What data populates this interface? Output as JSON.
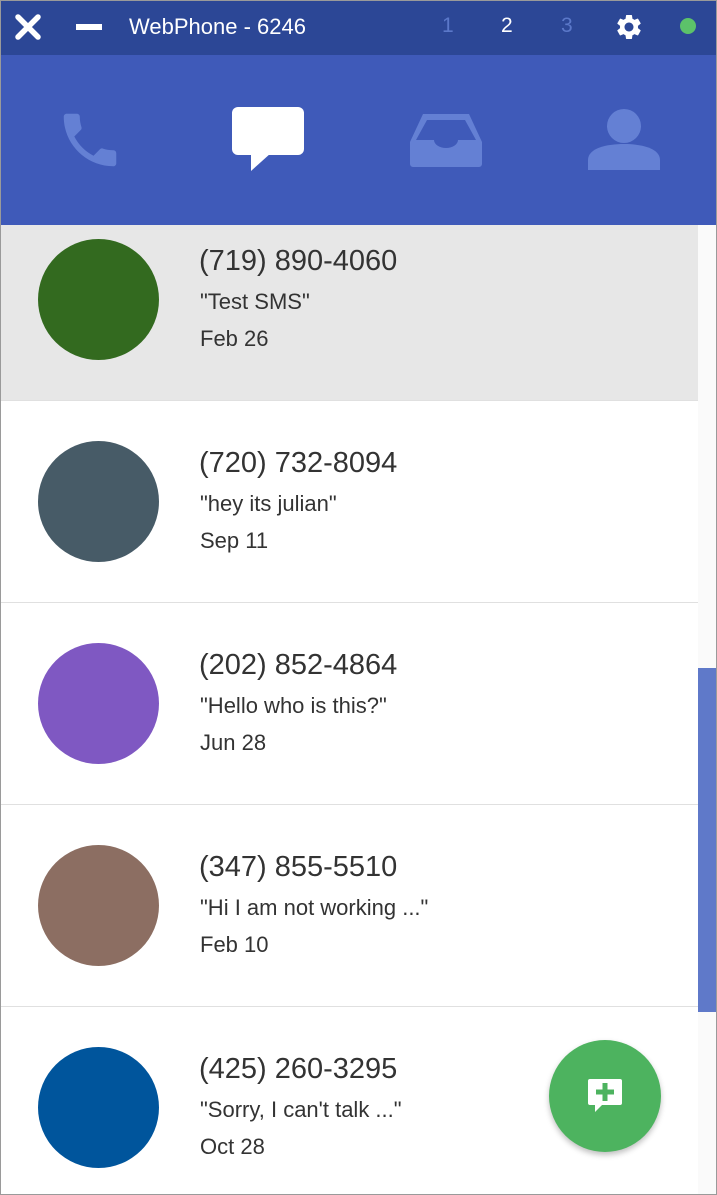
{
  "window": {
    "title": "WebPhone - 6246",
    "lines": [
      "1",
      "2",
      "3"
    ],
    "active_line": "2",
    "status_color": "#5cc26a"
  },
  "tabs": [
    {
      "icon": "phone-icon"
    },
    {
      "icon": "chat-bubble-icon",
      "active": true
    },
    {
      "icon": "inbox-tray-icon"
    },
    {
      "icon": "person-icon"
    }
  ],
  "conversations": [
    {
      "number": "(719) 890-4060",
      "message": "\"Test SMS\"",
      "date": "Feb 26",
      "avatar_color": "#336a1f",
      "selected": true
    },
    {
      "number": "(720) 732-8094",
      "message": "\"hey its julian\"",
      "date": "Sep 11",
      "avatar_color": "#475b67",
      "selected": false
    },
    {
      "number": "(202) 852-4864",
      "message": "\"Hello who is this?\"",
      "date": "Jun 28",
      "avatar_color": "#7f58c2",
      "selected": false
    },
    {
      "number": "(347) 855-5510",
      "message": "\"Hi I am not working ...\"",
      "date": "Feb 10",
      "avatar_color": "#8c6e62",
      "selected": false
    },
    {
      "number": "(425) 260-3295",
      "message": "\"Sorry, I can't talk ...\"",
      "date": "Oct 28",
      "avatar_color": "#00559c",
      "selected": false
    }
  ],
  "colors": {
    "titlebar": "#2c4796",
    "tabbar": "#3f5ab9",
    "tab_inactive_icon": "#6480d4",
    "tab_active_icon": "#ffffff",
    "fab": "#4db35f",
    "scroll_thumb": "#5f79c9"
  },
  "fab": {
    "icon": "new-message-icon"
  }
}
